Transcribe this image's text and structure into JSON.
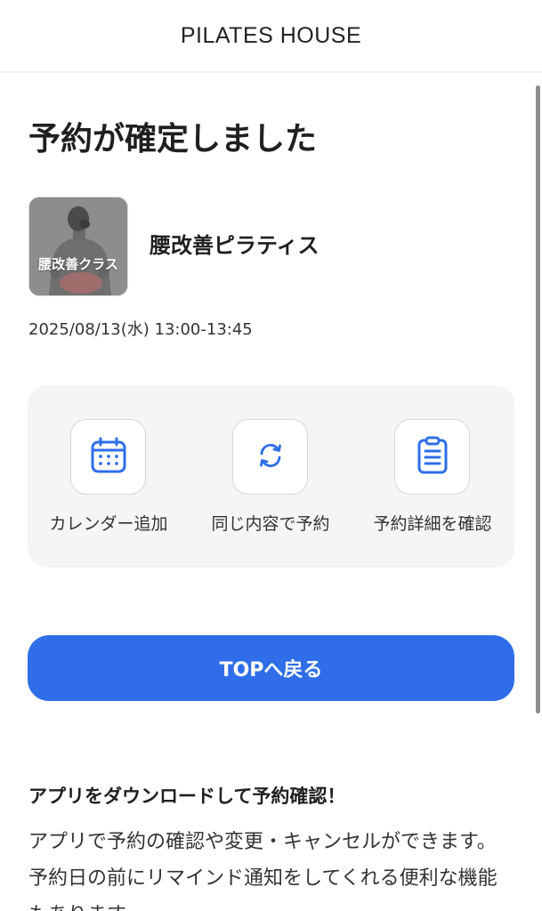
{
  "header": {
    "brand": "PILATES HOUSE"
  },
  "confirmation": {
    "title": "予約が確定しました"
  },
  "class": {
    "thumbnail_label": "腰改善クラス",
    "name": "腰改善ピラティス",
    "datetime": "2025/08/13(水) 13:00-13:45"
  },
  "actions": [
    {
      "label": "カレンダー追加",
      "icon": "calendar-icon"
    },
    {
      "label": "同じ内容で予約",
      "icon": "refresh-icon"
    },
    {
      "label": "予約詳細を確認",
      "icon": "clipboard-list-icon"
    }
  ],
  "top_button": {
    "label": "TOPへ戻る"
  },
  "app_promo": {
    "heading": "アプリをダウンロードして予約確認！",
    "body": "アプリで予約の確認や変更・キャンセルができます。予約日の前にリマインド通知をしてくれる便利な機能もあります。"
  },
  "colors": {
    "accent": "#2f6ee8",
    "icon_blue": "#2f6ee8",
    "panel_bg": "#f5f5f5"
  }
}
